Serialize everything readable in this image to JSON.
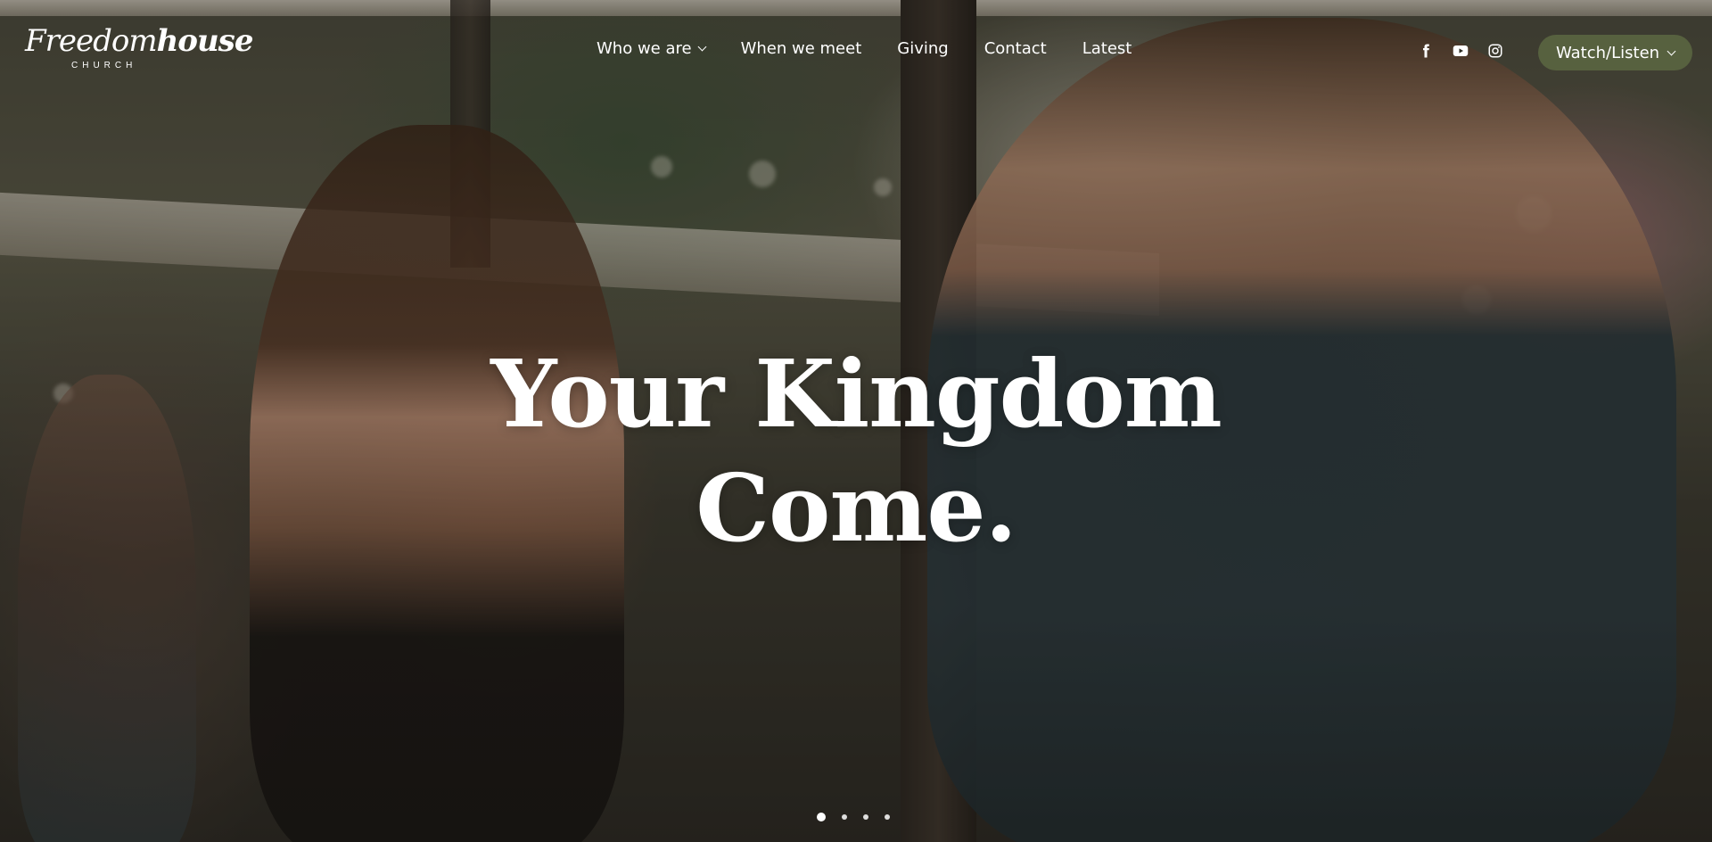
{
  "logo": {
    "wordmark_thin": "Freedom",
    "wordmark_bold": "house",
    "subtitle": "CHURCH"
  },
  "nav": {
    "items": [
      {
        "label": "Who we are",
        "has_dropdown": true
      },
      {
        "label": "When we meet",
        "has_dropdown": false
      },
      {
        "label": "Giving",
        "has_dropdown": false
      },
      {
        "label": "Contact",
        "has_dropdown": false
      },
      {
        "label": "Latest",
        "has_dropdown": false
      }
    ]
  },
  "social": {
    "icons": [
      "facebook-icon",
      "youtube-icon",
      "instagram-icon"
    ]
  },
  "watch_button": {
    "label": "Watch/Listen",
    "color": "#57613f"
  },
  "hero": {
    "headline_line1": "Your Kingdom",
    "headline_line2": "Come."
  },
  "slider": {
    "total_slides": 4,
    "active_index": 0
  }
}
